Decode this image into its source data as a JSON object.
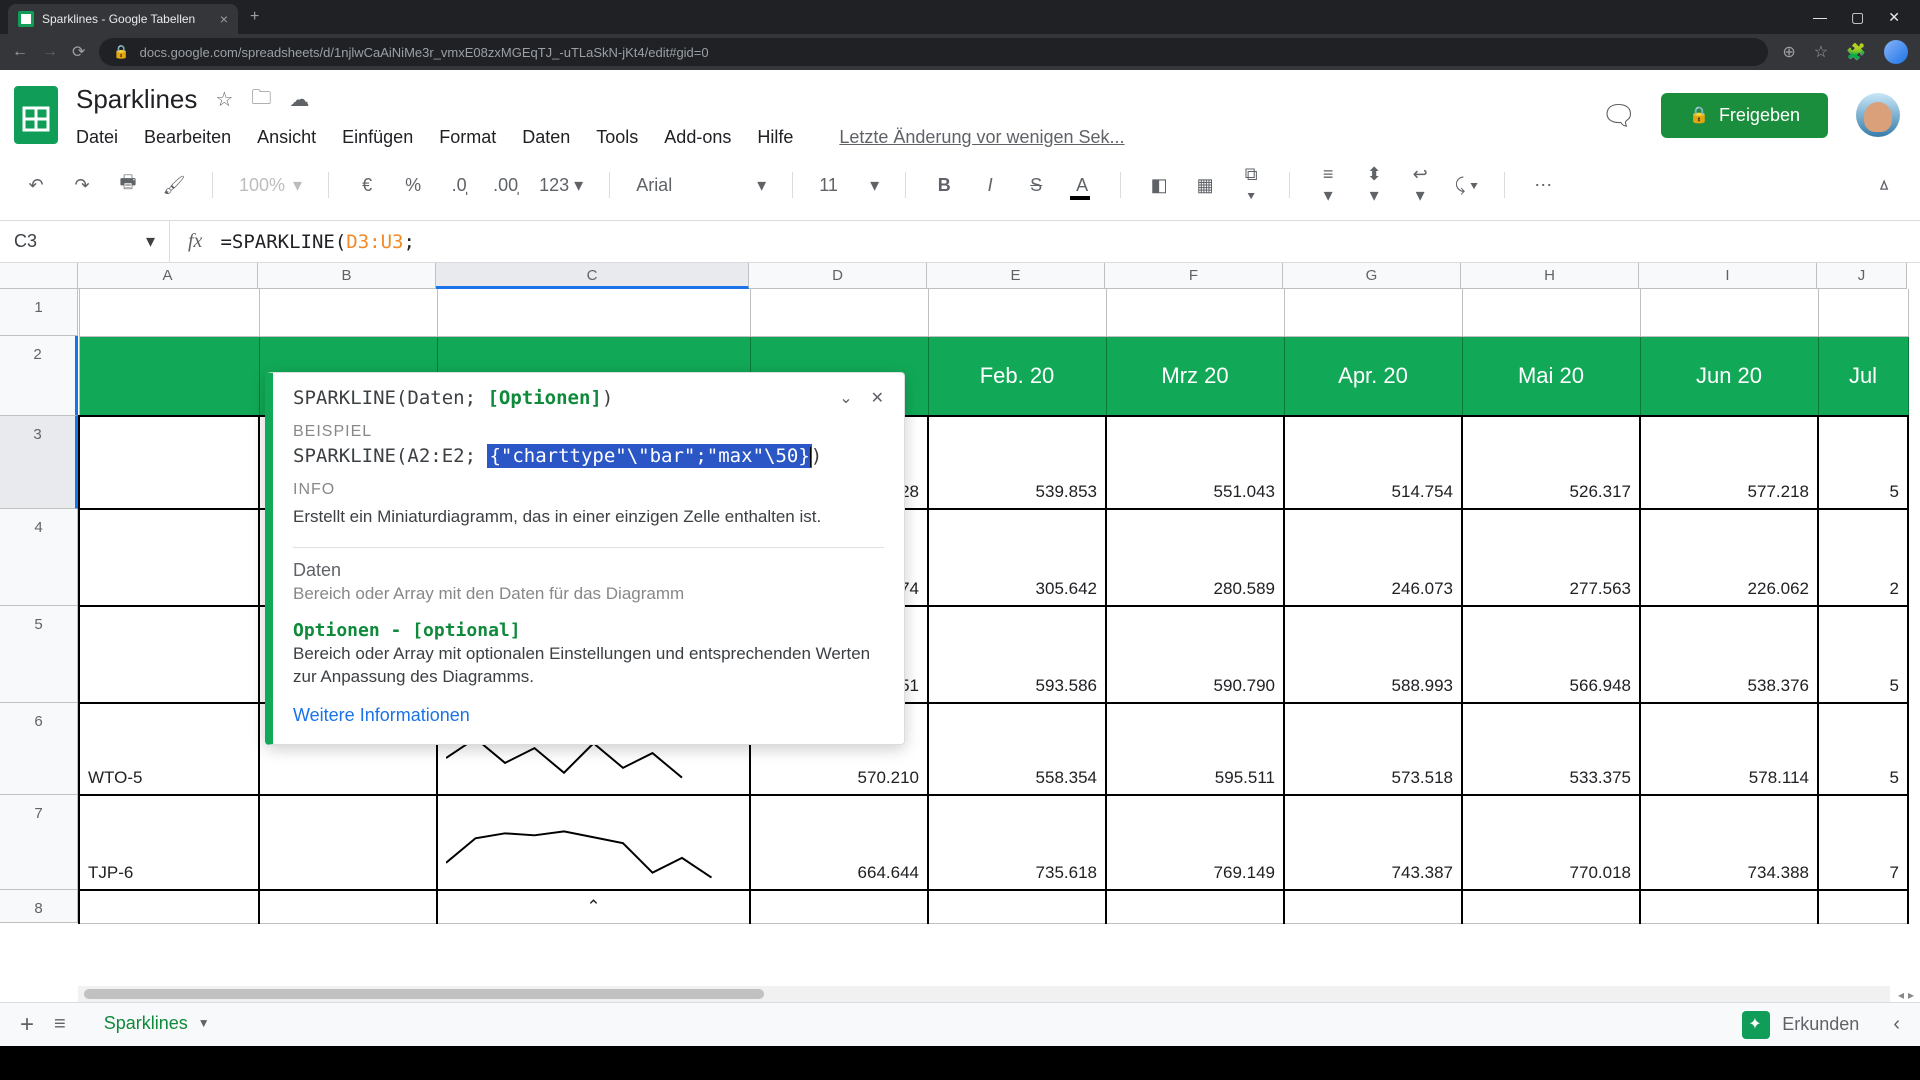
{
  "browser": {
    "tab_title": "Sparklines - Google Tabellen",
    "url": "docs.google.com/spreadsheets/d/1njlwCaAiNiMe3r_vmxE08zxMGEqTJ_-uTLaSkN-jKt4/edit#gid=0"
  },
  "doc": {
    "name": "Sparklines",
    "last_edit": "Letzte Änderung vor wenigen Sek...",
    "share_label": "Freigeben"
  },
  "menus": [
    "Datei",
    "Bearbeiten",
    "Ansicht",
    "Einfügen",
    "Format",
    "Daten",
    "Tools",
    "Add-ons",
    "Hilfe"
  ],
  "toolbar": {
    "zoom": "100%",
    "font": "Arial",
    "size": "11",
    "num_fmt": "123"
  },
  "namebox": "C3",
  "formula": {
    "prefix": "=SPARKLINE(",
    "range": "D3:U3",
    "suffix": ";"
  },
  "tooltip": {
    "sig_fn": "SPARKLINE(Daten; ",
    "sig_opt": "[Optionen]",
    "sig_close": ")",
    "example_label": "BEISPIEL",
    "example_prefix": "SPARKLINE(A2:E2; ",
    "example_hl": "{\"charttype\"\\\"bar\";\"max\"\\50}",
    "example_suffix": ")",
    "info_label": "INFO",
    "info_text": "Erstellt ein Miniaturdiagramm, das in einer einzigen Zelle enthalten ist.",
    "p1_name": "Daten",
    "p1_desc": "Bereich oder Array mit den Daten für das Diagramm",
    "p2_name": "Optionen - [optional]",
    "p2_desc": "Bereich oder Array mit optionalen Einstellungen und entsprechenden Werten zur Anpassung des Diagramms.",
    "link": "Weitere Informationen"
  },
  "columns": [
    "A",
    "B",
    "C",
    "D",
    "E",
    "F",
    "G",
    "H",
    "I",
    "J"
  ],
  "header_row": [
    "",
    "",
    "",
    "",
    "Feb. 20",
    "Mrz 20",
    "Apr. 20",
    "Mai 20",
    "Jun 20",
    "Jul"
  ],
  "rows": [
    {
      "label": "",
      "d": "28",
      "e": "539.853",
      "f": "551.043",
      "g": "514.754",
      "h": "526.317",
      "i": "577.218",
      "j": "5"
    },
    {
      "label": "",
      "d": "74",
      "e": "305.642",
      "f": "280.589",
      "g": "246.073",
      "h": "277.563",
      "i": "226.062",
      "j": "2"
    },
    {
      "label": "",
      "d": "51",
      "e": "593.586",
      "f": "590.790",
      "g": "588.993",
      "h": "566.948",
      "i": "538.376",
      "j": "5"
    },
    {
      "label": "WTO-5",
      "d": "570.210",
      "e": "558.354",
      "f": "595.511",
      "g": "573.518",
      "h": "533.375",
      "i": "578.114",
      "j": "5"
    },
    {
      "label": "TJP-6",
      "d": "664.644",
      "e": "735.618",
      "f": "769.149",
      "g": "743.387",
      "h": "770.018",
      "i": "734.388",
      "j": "7"
    }
  ],
  "sheet_tab": "Sparklines",
  "explore": "Erkunden"
}
